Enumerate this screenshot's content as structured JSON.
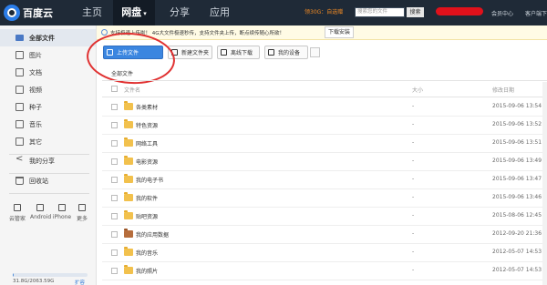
{
  "topbar": {
    "logo_text": "百度云",
    "nav": [
      {
        "label": "主页"
      },
      {
        "label": "网盘",
        "caret": "▾"
      },
      {
        "label": "分享"
      },
      {
        "label": "应用"
      }
    ],
    "promo_text": "领30G：自选赠",
    "search_placeholder": "搜索您的文件",
    "search_button": "搜索",
    "links": {
      "member": "会员中心",
      "client": "客户端下"
    }
  },
  "sidebar": {
    "items": [
      {
        "label": "全部文件",
        "icon": "folder-icon",
        "active": true
      },
      {
        "label": "图片",
        "icon": "image-icon"
      },
      {
        "label": "文档",
        "icon": "document-icon"
      },
      {
        "label": "视频",
        "icon": "video-icon"
      },
      {
        "label": "种子",
        "icon": "torrent-icon"
      },
      {
        "label": "音乐",
        "icon": "music-icon"
      },
      {
        "label": "其它",
        "icon": "more-icon"
      }
    ],
    "share_label": "我的分享",
    "trash_label": "回收站",
    "devices": [
      "云管家",
      "Android",
      "iPhone",
      "更多"
    ],
    "quota_text": "31.8G/2063.59G",
    "quota_used_fraction": 0.015,
    "quota_link": "扩容"
  },
  "notice": {
    "text": "支持极速上传啦！ 4G大文件极速秒传，支持文件夹上传，断点续传随心所欲！",
    "link": "下载安装"
  },
  "toolbar": {
    "upload": "上传文件",
    "new_folder": "新建文件夹",
    "offline": "离线下载",
    "device": "我的设备"
  },
  "breadcrumb": "全部文件",
  "table": {
    "headers": {
      "name": "文件名",
      "size": "大小",
      "date": "修改日期"
    },
    "rows": [
      {
        "name": "各类素材",
        "size": "-",
        "date": "2015-09-06 13:54",
        "icon": "folder-icon"
      },
      {
        "name": "特色资源",
        "size": "-",
        "date": "2015-09-06 13:52",
        "icon": "folder-icon"
      },
      {
        "name": "网络工具",
        "size": "-",
        "date": "2015-09-06 13:51",
        "icon": "folder-icon"
      },
      {
        "name": "电影资源",
        "size": "-",
        "date": "2015-09-06 13:49",
        "icon": "folder-icon"
      },
      {
        "name": "我的电子书",
        "size": "-",
        "date": "2015-09-06 13:47",
        "icon": "folder-icon"
      },
      {
        "name": "我的软件",
        "size": "-",
        "date": "2015-09-06 13:46",
        "icon": "folder-icon"
      },
      {
        "name": "贴吧资源",
        "size": "-",
        "date": "2015-08-06 12:45",
        "icon": "folder-icon"
      },
      {
        "name": "我的应用数据",
        "size": "-",
        "date": "2012-09-20 21:36",
        "icon": "app-folder-icon"
      },
      {
        "name": "我的音乐",
        "size": "-",
        "date": "2012-05-07 14:53",
        "icon": "folder-icon"
      },
      {
        "name": "我的照片",
        "size": "-",
        "date": "2012-05-07 14:53",
        "icon": "folder-icon"
      }
    ]
  }
}
